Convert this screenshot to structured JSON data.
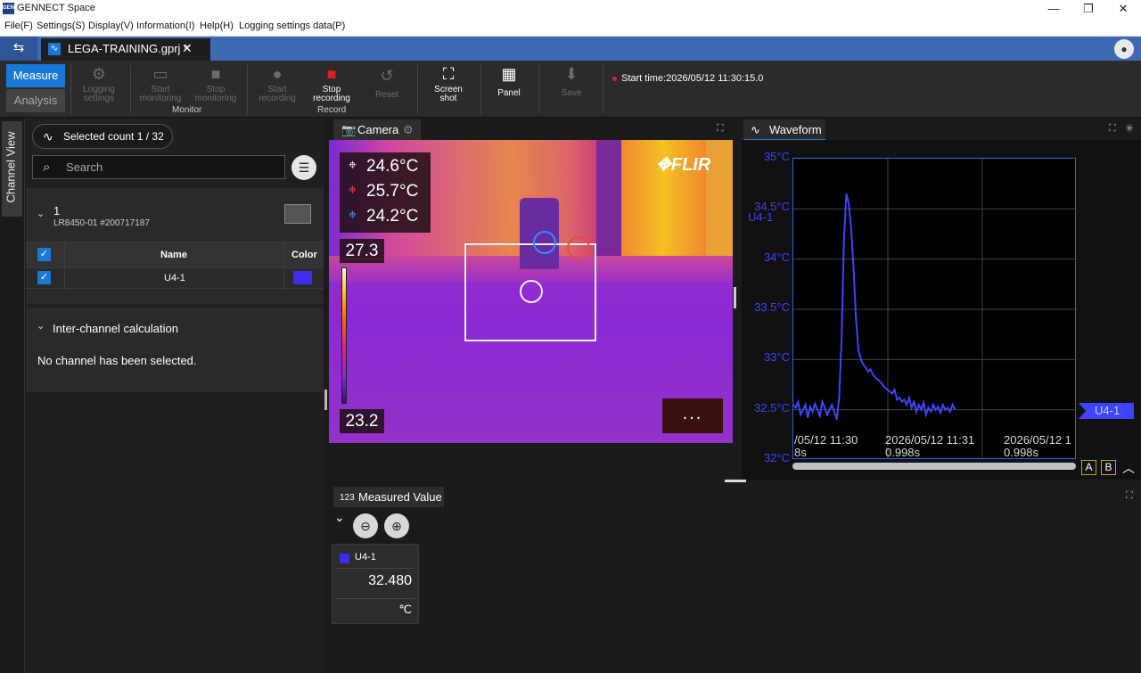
{
  "app": {
    "title": "GENNECT Space",
    "icon_text": "GEN"
  },
  "window_controls": {
    "minimize": "—",
    "maximize": "❐",
    "close": "✕"
  },
  "menu": [
    "File(F)",
    "Settings(S)",
    "Display(V)",
    "Information(I)",
    "Help(H)",
    "Logging settings data(P)"
  ],
  "tabs": {
    "project": "LEGA-TRAINING.gprj *",
    "close": "✕"
  },
  "toolbar": {
    "measure": "Measure",
    "analysis": "Analysis",
    "logging_settings": "Logging settings",
    "start_monitoring": "Start monitoring",
    "stop_monitoring": "Stop monitoring",
    "monitor_group": "Monitor",
    "start_recording": "Start recording",
    "stop_recording": "Stop recording",
    "record_group": "Record",
    "reset": "Reset",
    "screenshot": "Screen shot",
    "panel": "Panel",
    "save": "Save",
    "start_time": "Start time:2026/05/12 11:30:15.0"
  },
  "sidebar": {
    "channel_view": "Channel View",
    "selected_count": "Selected count 1 / 32",
    "search_placeholder": "Search",
    "device": {
      "number": "1",
      "name": "LR8450-01 #200717187"
    },
    "table": {
      "headers": {
        "name": "Name",
        "color": "Color"
      },
      "rows": [
        {
          "name": "U4-1",
          "color": "#3b2df0"
        }
      ]
    },
    "inter_channel": {
      "title": "Inter-channel calculation",
      "empty": "No channel has been selected."
    }
  },
  "camera": {
    "title": "Camera",
    "center_temp": "24.6°C",
    "max_temp": "25.7°C",
    "min_temp": "24.2°C",
    "scale_max": "27.3",
    "scale_min": "23.2",
    "brand": "FLIR",
    "more": "..."
  },
  "waveform": {
    "title": "Waveform",
    "channel_label": "U4-1",
    "cursor_label": "U4-1",
    "y_ticks": [
      "35°C",
      "34.5°C",
      "34°C",
      "33.5°C",
      "33°C",
      "32.5°C",
      "32°C"
    ],
    "x_ticks": [
      "/05/12 11:30\n8s",
      "2026/05/12 11:31\n0.998s",
      "2026/05/12 1\n0.998s"
    ],
    "cursor_a": "A",
    "cursor_b": "B"
  },
  "measured_value": {
    "title": "Measured Value",
    "tab_icon": "123",
    "card": {
      "channel": "U4-1",
      "value": "32.480",
      "unit": "℃",
      "color": "#3b2df0"
    }
  },
  "chart_data": {
    "type": "line",
    "series": [
      {
        "name": "U4-1",
        "color": "#3d44ff",
        "points_time_s": [
          0,
          2,
          4,
          6,
          8,
          10,
          12,
          14,
          16,
          18,
          20,
          22,
          24,
          26,
          28,
          30,
          32,
          34,
          36,
          38,
          40,
          42,
          44,
          46,
          48,
          50,
          52,
          54,
          56,
          58,
          60,
          62,
          64,
          66,
          68,
          70,
          72,
          74,
          76,
          78,
          80,
          82,
          84,
          86,
          88,
          90,
          92,
          94,
          96,
          98,
          100,
          102,
          104,
          106,
          108,
          110,
          112,
          114,
          116,
          118,
          120,
          122,
          124,
          126,
          128,
          130,
          132,
          134
        ],
        "values": [
          32.55,
          32.52,
          32.58,
          32.45,
          32.5,
          32.55,
          32.42,
          32.53,
          32.48,
          32.56,
          32.5,
          32.44,
          32.58,
          32.52,
          32.45,
          32.5,
          32.55,
          32.48,
          32.4,
          32.62,
          33.2,
          34.2,
          34.65,
          34.55,
          34.3,
          33.9,
          33.4,
          33.1,
          33.0,
          32.95,
          32.92,
          32.88,
          32.9,
          32.85,
          32.82,
          32.8,
          32.78,
          32.75,
          32.72,
          32.7,
          32.68,
          32.66,
          32.7,
          32.6,
          32.62,
          32.58,
          32.6,
          32.55,
          32.62,
          32.52,
          32.58,
          32.48,
          32.55,
          32.5,
          32.57,
          32.45,
          32.52,
          32.48,
          32.55,
          32.5,
          32.53,
          32.47,
          32.55,
          32.5,
          32.52,
          32.48,
          32.55,
          32.5
        ]
      }
    ],
    "ylim": [
      32,
      35
    ],
    "ylabel": "",
    "xlabel": ""
  }
}
